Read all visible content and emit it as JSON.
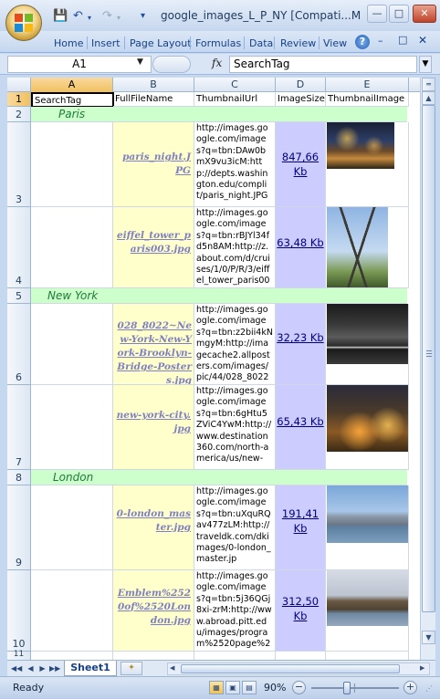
{
  "window": {
    "title": "google_images_L_P_NY  [Compati...M",
    "min_icon": "minimize-icon",
    "max_icon": "maximize-icon",
    "close_icon": "close-icon"
  },
  "ribbon": {
    "tabs": [
      "Home",
      "Insert",
      "Page Layout",
      "Formulas",
      "Data",
      "Review",
      "View"
    ],
    "help_glyph": "?",
    "doc_min": "–",
    "doc_restore": "□",
    "doc_close": "✕"
  },
  "formula_bar": {
    "name_box": "A1",
    "fx": "fx",
    "content": "SearchTag"
  },
  "columns": [
    "A",
    "B",
    "C",
    "D",
    "E"
  ],
  "rows": [
    "1",
    "2",
    "3",
    "4",
    "5",
    "6",
    "7",
    "8",
    "9",
    "10",
    "11"
  ],
  "header_row": {
    "a": "SearchTag",
    "b": "FullFileName",
    "c": "ThumbnailUrl",
    "d": "ImageSize",
    "e": "ThumbnailImage"
  },
  "groups": {
    "paris": "Paris",
    "new_york": "New York",
    "london": "London"
  },
  "records": [
    {
      "file": "paris_night.JPG",
      "url": "http://images.google.com/images?q=tbn:DAw0bmX9vu3icM:http://depts.washington.edu/complit/paris_night.JPG",
      "size": "847,66 Kb",
      "thumb": "paris-night-photo"
    },
    {
      "file": "eiffel_tower_paris003.jpg",
      "url": "http://images.google.com/images?q=tbn:rBJYl34fd5n8AM:http://z.about.com/d/cruises/1/0/P/R/3/eiffel_tower_paris003.jpg",
      "size": "63,48 Kb",
      "thumb": "eiffel-tower-photo"
    },
    {
      "file": "028_8022~New-York-New-York-Brooklyn-Bridge-Posters.jpg",
      "url": "http://images.google.com/images?q=tbn:z2bii4kNmgyM:http://imagecache2.allposters.com/images/pic/44/028_8022~New-",
      "size": "32,23 Kb",
      "thumb": "brooklyn-bridge-photo"
    },
    {
      "file": "new-york-city.jpg",
      "url": "http://images.google.com/images?q=tbn:6gHtu5ZViC4YwM:http://www.destination360.com/north-america/us/new-",
      "size": "65,43 Kb",
      "thumb": "new-york-city-photo"
    },
    {
      "file": "0-london_master.jpg",
      "url": "http://images.google.com/images?q=tbn:uXquRQav477zLM:http://traveldk.com/dkimages/0-london_master.jp",
      "size": "191,41 Kb",
      "thumb": "london-skyline-photo"
    },
    {
      "file": "Emblem%2520of%2520London.jpg",
      "url": "http://images.google.com/images?q=tbn:5j36QGj8xi-zrM:http://www.abroad.pitt.edu/images/program%2520page%2520imag",
      "size": "312,50 Kb",
      "thumb": "westminster-photo"
    }
  ],
  "sheets": {
    "active": "Sheet1"
  },
  "status": {
    "text": "Ready",
    "zoom": "90%"
  },
  "colors": {
    "group_row": "#ccffcc",
    "file_col": "#ffffcc",
    "size_col": "#ccccff",
    "link": "#8080c0"
  }
}
